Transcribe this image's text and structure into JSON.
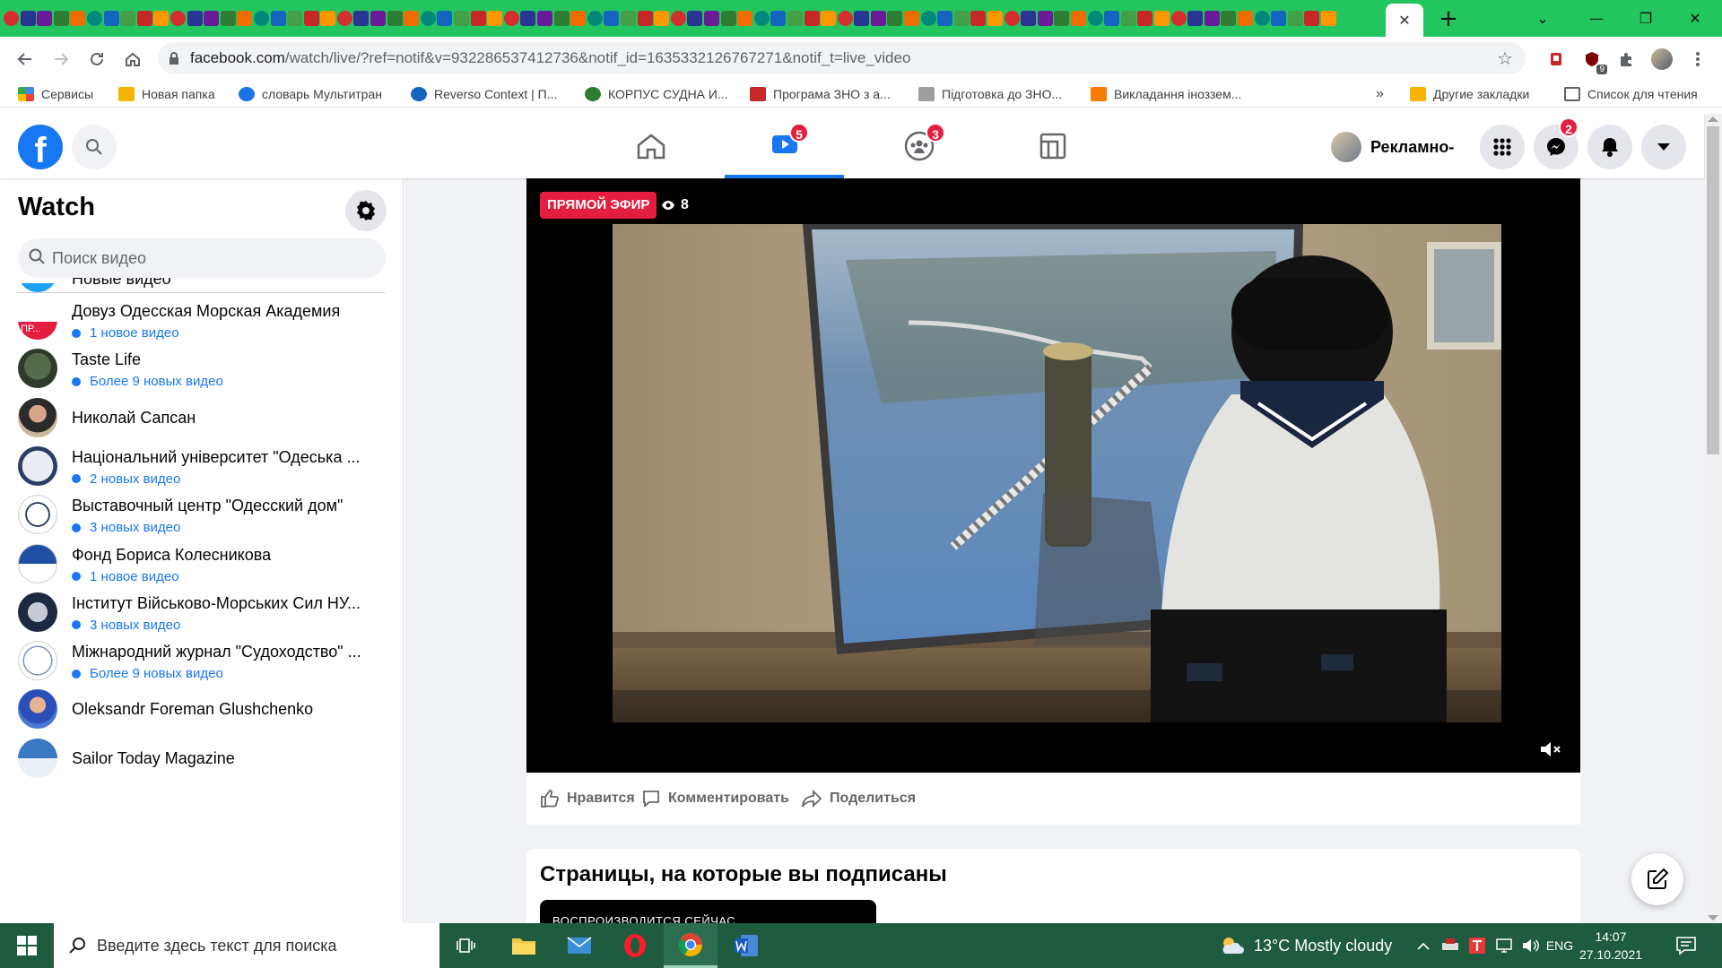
{
  "browser": {
    "url_host": "facebook.com",
    "url_rest": "/watch/live/?ref=notif&v=932286537412736&notif_id=1635332126767271&notif_t=live_video",
    "extension_badge": "9"
  },
  "bookmarks": [
    {
      "label": "Сервисы",
      "icon_color": "#4285f4"
    },
    {
      "label": "Новая папка",
      "icon_color": "#f4b400"
    },
    {
      "label": "словарь Мультитран",
      "icon_color": "#1a73e8"
    },
    {
      "label": "Reverso Context | П...",
      "icon_color": "#1565c0"
    },
    {
      "label": "КОРПУС СУДНА И...",
      "icon_color": "#2e7d32"
    },
    {
      "label": "Програма ЗНО з а...",
      "icon_color": "#c62828"
    },
    {
      "label": "Підготовка до ЗНО...",
      "icon_color": "#9e9e9e"
    },
    {
      "label": "Викладання іноззем...",
      "icon_color": "#f57c00"
    }
  ],
  "bookmarks_more": "»",
  "bookmarks_right": [
    {
      "label": "Другие закладки",
      "icon_color": "#f4b400"
    },
    {
      "label": "Список для чтения",
      "icon_color": "#5f6368"
    }
  ],
  "fb": {
    "nav_badges": {
      "watch": "5",
      "groups": "3"
    },
    "profile_name": "Рекламно-",
    "messenger_badge": "2"
  },
  "sidebar": {
    "title": "Watch",
    "search_placeholder": "Поиск видео",
    "partial_item": "Новые видео",
    "items": [
      {
        "name": "Довуз Одесская Морская Академия",
        "sub": "1 новое видео",
        "avatar": "academy",
        "live_label": "ПР..."
      },
      {
        "name": "Taste Life",
        "sub": "Более 9 новых видео",
        "avatar": "taste"
      },
      {
        "name": "Николай Сапсан",
        "sub": "",
        "avatar": "person"
      },
      {
        "name": "Національний університет \"Одеська ...",
        "sub": "2 новых видео",
        "avatar": "ship"
      },
      {
        "name": "Выставочный центр \"Одесский дом\"",
        "sub": "3 новых видео",
        "avatar": "expo"
      },
      {
        "name": "Фонд Бориса Колесникова",
        "sub": "1 новое видео",
        "avatar": "fund"
      },
      {
        "name": "Інститут Військово-Морських Сил НУ...",
        "sub": "3 новых видео",
        "avatar": "navy"
      },
      {
        "name": "Міжнародний журнал \"Судоходство\" ...",
        "sub": "Более 9 новых видео",
        "avatar": "journal"
      },
      {
        "name": "Oleksandr Foreman Glushchenko",
        "sub": "",
        "avatar": "person2"
      },
      {
        "name": "Sailor Today Magazine",
        "sub": "",
        "avatar": "sailor"
      }
    ]
  },
  "video": {
    "live_label": "ПРЯМОЙ ЭФИР",
    "viewer_count": "8"
  },
  "actions": {
    "like": "Нравится",
    "comment": "Комментировать",
    "share": "Поделиться"
  },
  "pages_section": {
    "title": "Страницы, на которые вы подписаны",
    "now_playing": "ВОСПРОИЗВОДИТСЯ СЕЙЧАС"
  },
  "taskbar": {
    "search_placeholder": "Введите здесь текст для поиска",
    "weather": "13°C  Mostly cloudy",
    "lang": "ENG",
    "time": "14:07",
    "date": "27.10.2021"
  },
  "colors": {
    "facebook_blue": "#1877f2",
    "live_red": "#e41e3f",
    "tabstrip_green": "#22c55e",
    "taskbar_green": "#1e5b3f"
  }
}
